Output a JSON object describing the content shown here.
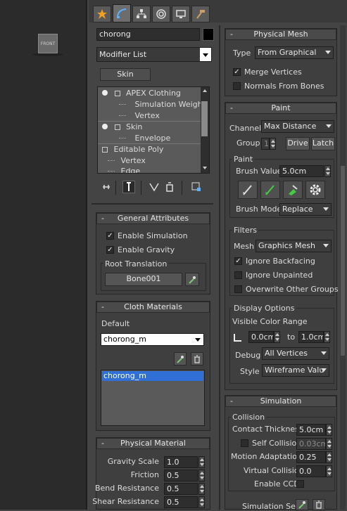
{
  "viewport": {
    "cube_label": "FRONT"
  },
  "command_panel": {
    "tabs": [
      "create",
      "modify",
      "hierarchy",
      "motion",
      "display",
      "utilities"
    ],
    "active_tab": "modify"
  },
  "object": {
    "name": "chorong",
    "color": "#000000"
  },
  "modifier_list": {
    "label": "Modifier List"
  },
  "modifier_button": "Skin",
  "stack": {
    "items": [
      {
        "label": "APEX Clothing",
        "indent": 1,
        "bulb": true,
        "box": true
      },
      {
        "label": "Simulation Weights",
        "indent": 2
      },
      {
        "label": "Vertex",
        "indent": 2
      },
      {
        "label": "Skin",
        "indent": 1,
        "bulb": true,
        "box": true
      },
      {
        "label": "Envelope",
        "indent": 2
      },
      {
        "label": "Editable Poly",
        "indent": 1,
        "box": true
      },
      {
        "label": "Vertex",
        "indent": 2
      },
      {
        "label": "Edge",
        "indent": 2
      }
    ]
  },
  "general_attributes": {
    "title": "General Attributes",
    "enable_simulation": "Enable Simulation",
    "enable_gravity": "Enable Gravity",
    "root_translation": "Root Translation",
    "bone": "Bone001"
  },
  "cloth_materials": {
    "title": "Cloth Materials",
    "default_label": "Default",
    "selected": "chorong_m",
    "list": [
      "chorong_m"
    ]
  },
  "physical_material": {
    "title": "Physical Material",
    "rows": [
      {
        "label": "Gravity Scale",
        "value": "1.0"
      },
      {
        "label": "Friction",
        "value": "0.5"
      },
      {
        "label": "Bend Resistance",
        "value": "0.5"
      },
      {
        "label": "Shear Resistance",
        "value": "0.5"
      }
    ]
  },
  "physical_mesh": {
    "title": "Physical Mesh",
    "type_label": "Type",
    "type_value": "From Graphical",
    "merge_vertices": "Merge Vertices",
    "normals_from_bones": "Normals From Bones"
  },
  "paint": {
    "title": "Paint",
    "channel_label": "Channel",
    "channel_value": "Max Distance",
    "group_label": "Group",
    "group_value": "1",
    "drive": "Drive",
    "latch": "Latch",
    "paint_group": "Paint",
    "brush_value_label": "Brush Value",
    "brush_value": "5.0cm",
    "brush_mode_label": "Brush Mode",
    "brush_mode_value": "Replace",
    "filters": "Filters",
    "mesh_label": "Mesh",
    "mesh_value": "Graphics Mesh",
    "ignore_backfacing": "Ignore Backfacing",
    "ignore_unpainted": "Ignore Unpainted",
    "overwrite_other_groups": "Overwrite Other Groups",
    "display_options": "Display Options",
    "visible_color_range": "Visible Color Range",
    "range_from": "0.0cm",
    "range_to_label": "to",
    "range_to": "1.0cm",
    "debug_label": "Debug",
    "debug_value": "All Vertices",
    "style_label": "Style",
    "style_value": "Wireframe Valu"
  },
  "simulation": {
    "title": "Simulation",
    "collision": "Collision",
    "contact_thickness_label": "Contact Thickness",
    "contact_thickness": "5.0cm",
    "self_collision_label": "Self Collision",
    "self_collision": "0.03cm",
    "motion_adaptation_label": "Motion Adaptation",
    "motion_adaptation": "0.25",
    "virtual_collision_label": "Virtual Collision",
    "virtual_collision": "0.0",
    "enable_ccd_label": "Enable CCD",
    "simulation_sets_label": "Simulation Sets"
  },
  "colors": {
    "selection": "#2f6fd6",
    "panel": "#444444"
  }
}
